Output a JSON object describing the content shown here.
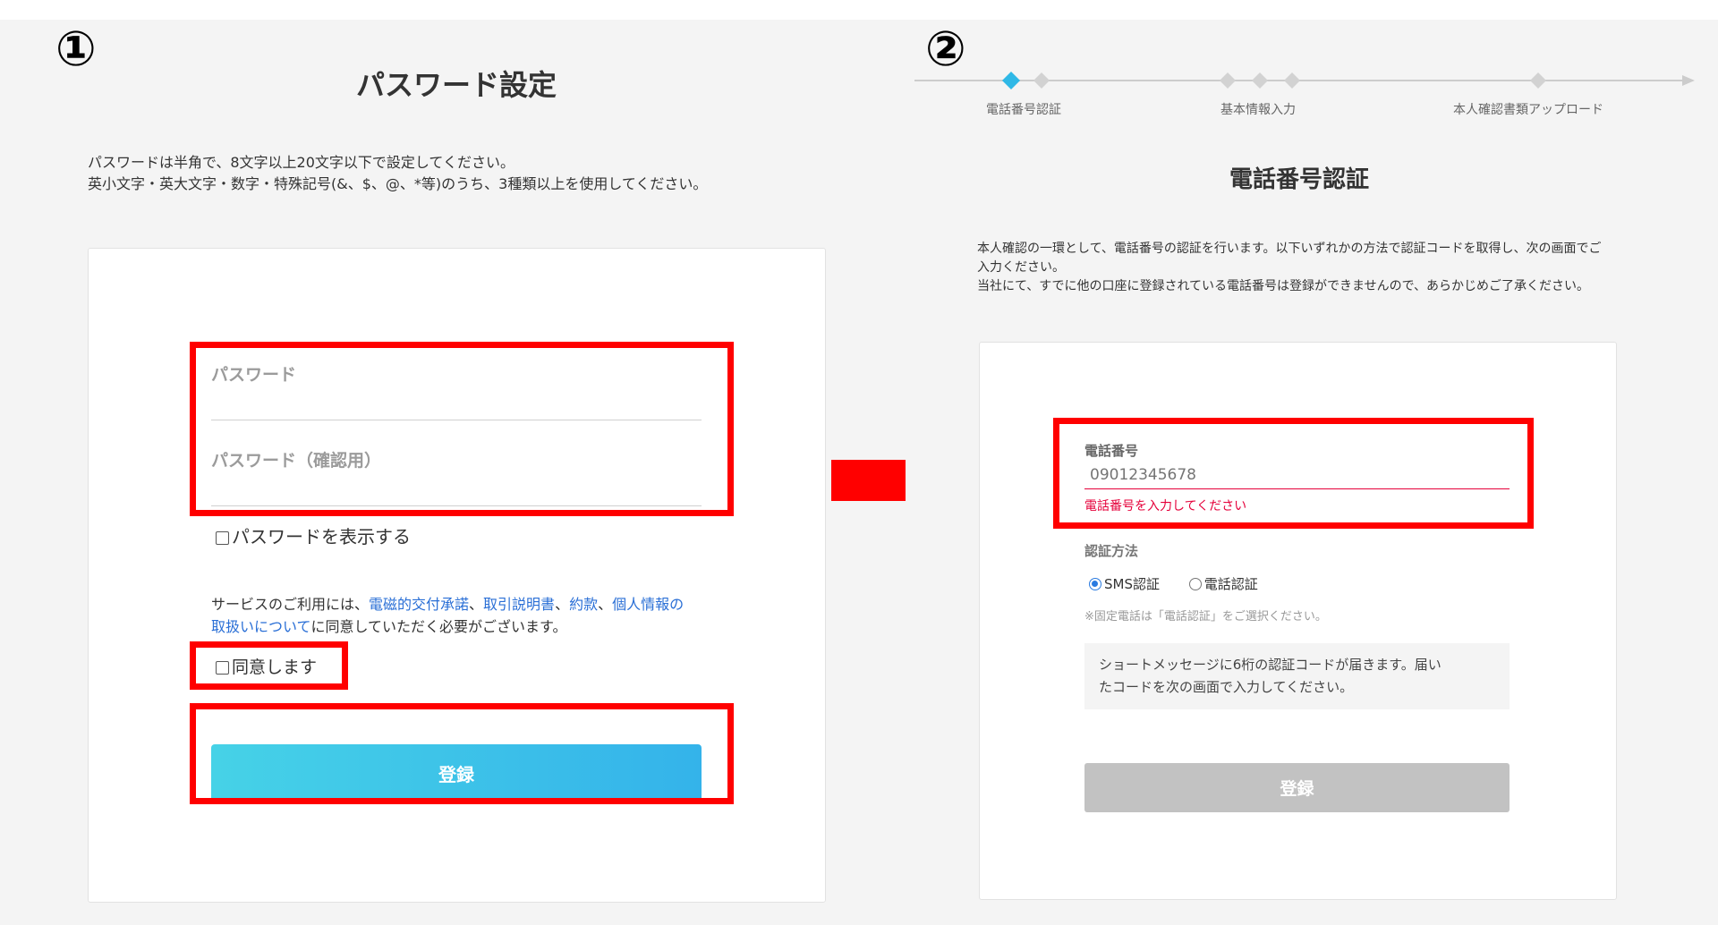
{
  "step1": {
    "number": "①",
    "title": "パスワード設定",
    "description": [
      "パスワードは半角で、8文字以上20文字以下で設定してください。",
      "英小文字・英大文字・数字・特殊記号(&、$、@、*等)のうち、3種類以上を使用してください。"
    ],
    "password_label": "パスワード",
    "password_confirm_label": "パスワード（確認用）",
    "show_password_label": "パスワードを表示する",
    "terms": {
      "prefix": "サービスのご利用には、",
      "link1": "電磁的交付承諾",
      "sep1": "、",
      "link2": "取引説明書",
      "sep2": "、",
      "link3": "約款",
      "sep3": "、",
      "link4a": "個人情報の",
      "link4b": "取扱いについて",
      "suffix": "に同意していただく必要がございます。"
    },
    "agree_label": "同意します",
    "submit_label": "登録"
  },
  "step2": {
    "number": "②",
    "progress_steps": [
      "電話番号認証",
      "基本情報入力",
      "本人確認書類アップロード"
    ],
    "title": "電話番号認証",
    "description": [
      "本人確認の一環として、電話番号の認証を行います。以下いずれかの方法で認証コードを取得し、次の画面でご",
      "入力ください。",
      "当社にて、すでに他の口座に登録されている電話番号は登録ができませんので、あらかじめご了承ください。"
    ],
    "phone_label": "電話番号",
    "phone_placeholder": "09012345678",
    "phone_error": "電話番号を入力してください",
    "method_label": "認証方法",
    "method_options": [
      "SMS認証",
      "電話認証"
    ],
    "note": "※固定電話は「電話認証」をご選択ください。",
    "info_text": [
      "ショートメッセージに6桁の認証コードが届きます。届い",
      "たコードを次の画面で入力してください。"
    ],
    "submit_label": "登録"
  },
  "colors": {
    "highlight": "#ff0000",
    "arrow": "#ff0000",
    "primary_gradient_start": "#46d2e7",
    "primary_gradient_end": "#34b3ea",
    "link": "#2a6fd6",
    "error": "#e5003a",
    "progress_active": "#2fb8e6"
  }
}
